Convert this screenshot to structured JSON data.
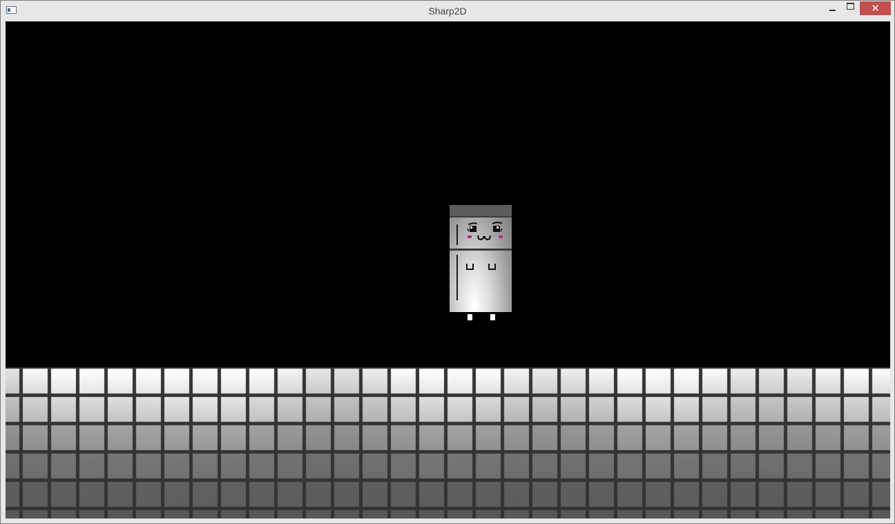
{
  "window": {
    "title": "Sharp2D",
    "icon": "app-window-icon",
    "controls": {
      "minimize": "minimize-icon",
      "maximize": "maximize-icon",
      "close_label": "✕"
    }
  },
  "scene": {
    "background_color": "#000000",
    "player": {
      "sprite": "fridge-character",
      "cheek_color": "#b0308a",
      "foot_color": "#ffffff"
    },
    "floor": {
      "tile_color_dark": "#555555",
      "tile_color_light": "#ffffff",
      "grout_color": "#333333"
    }
  }
}
